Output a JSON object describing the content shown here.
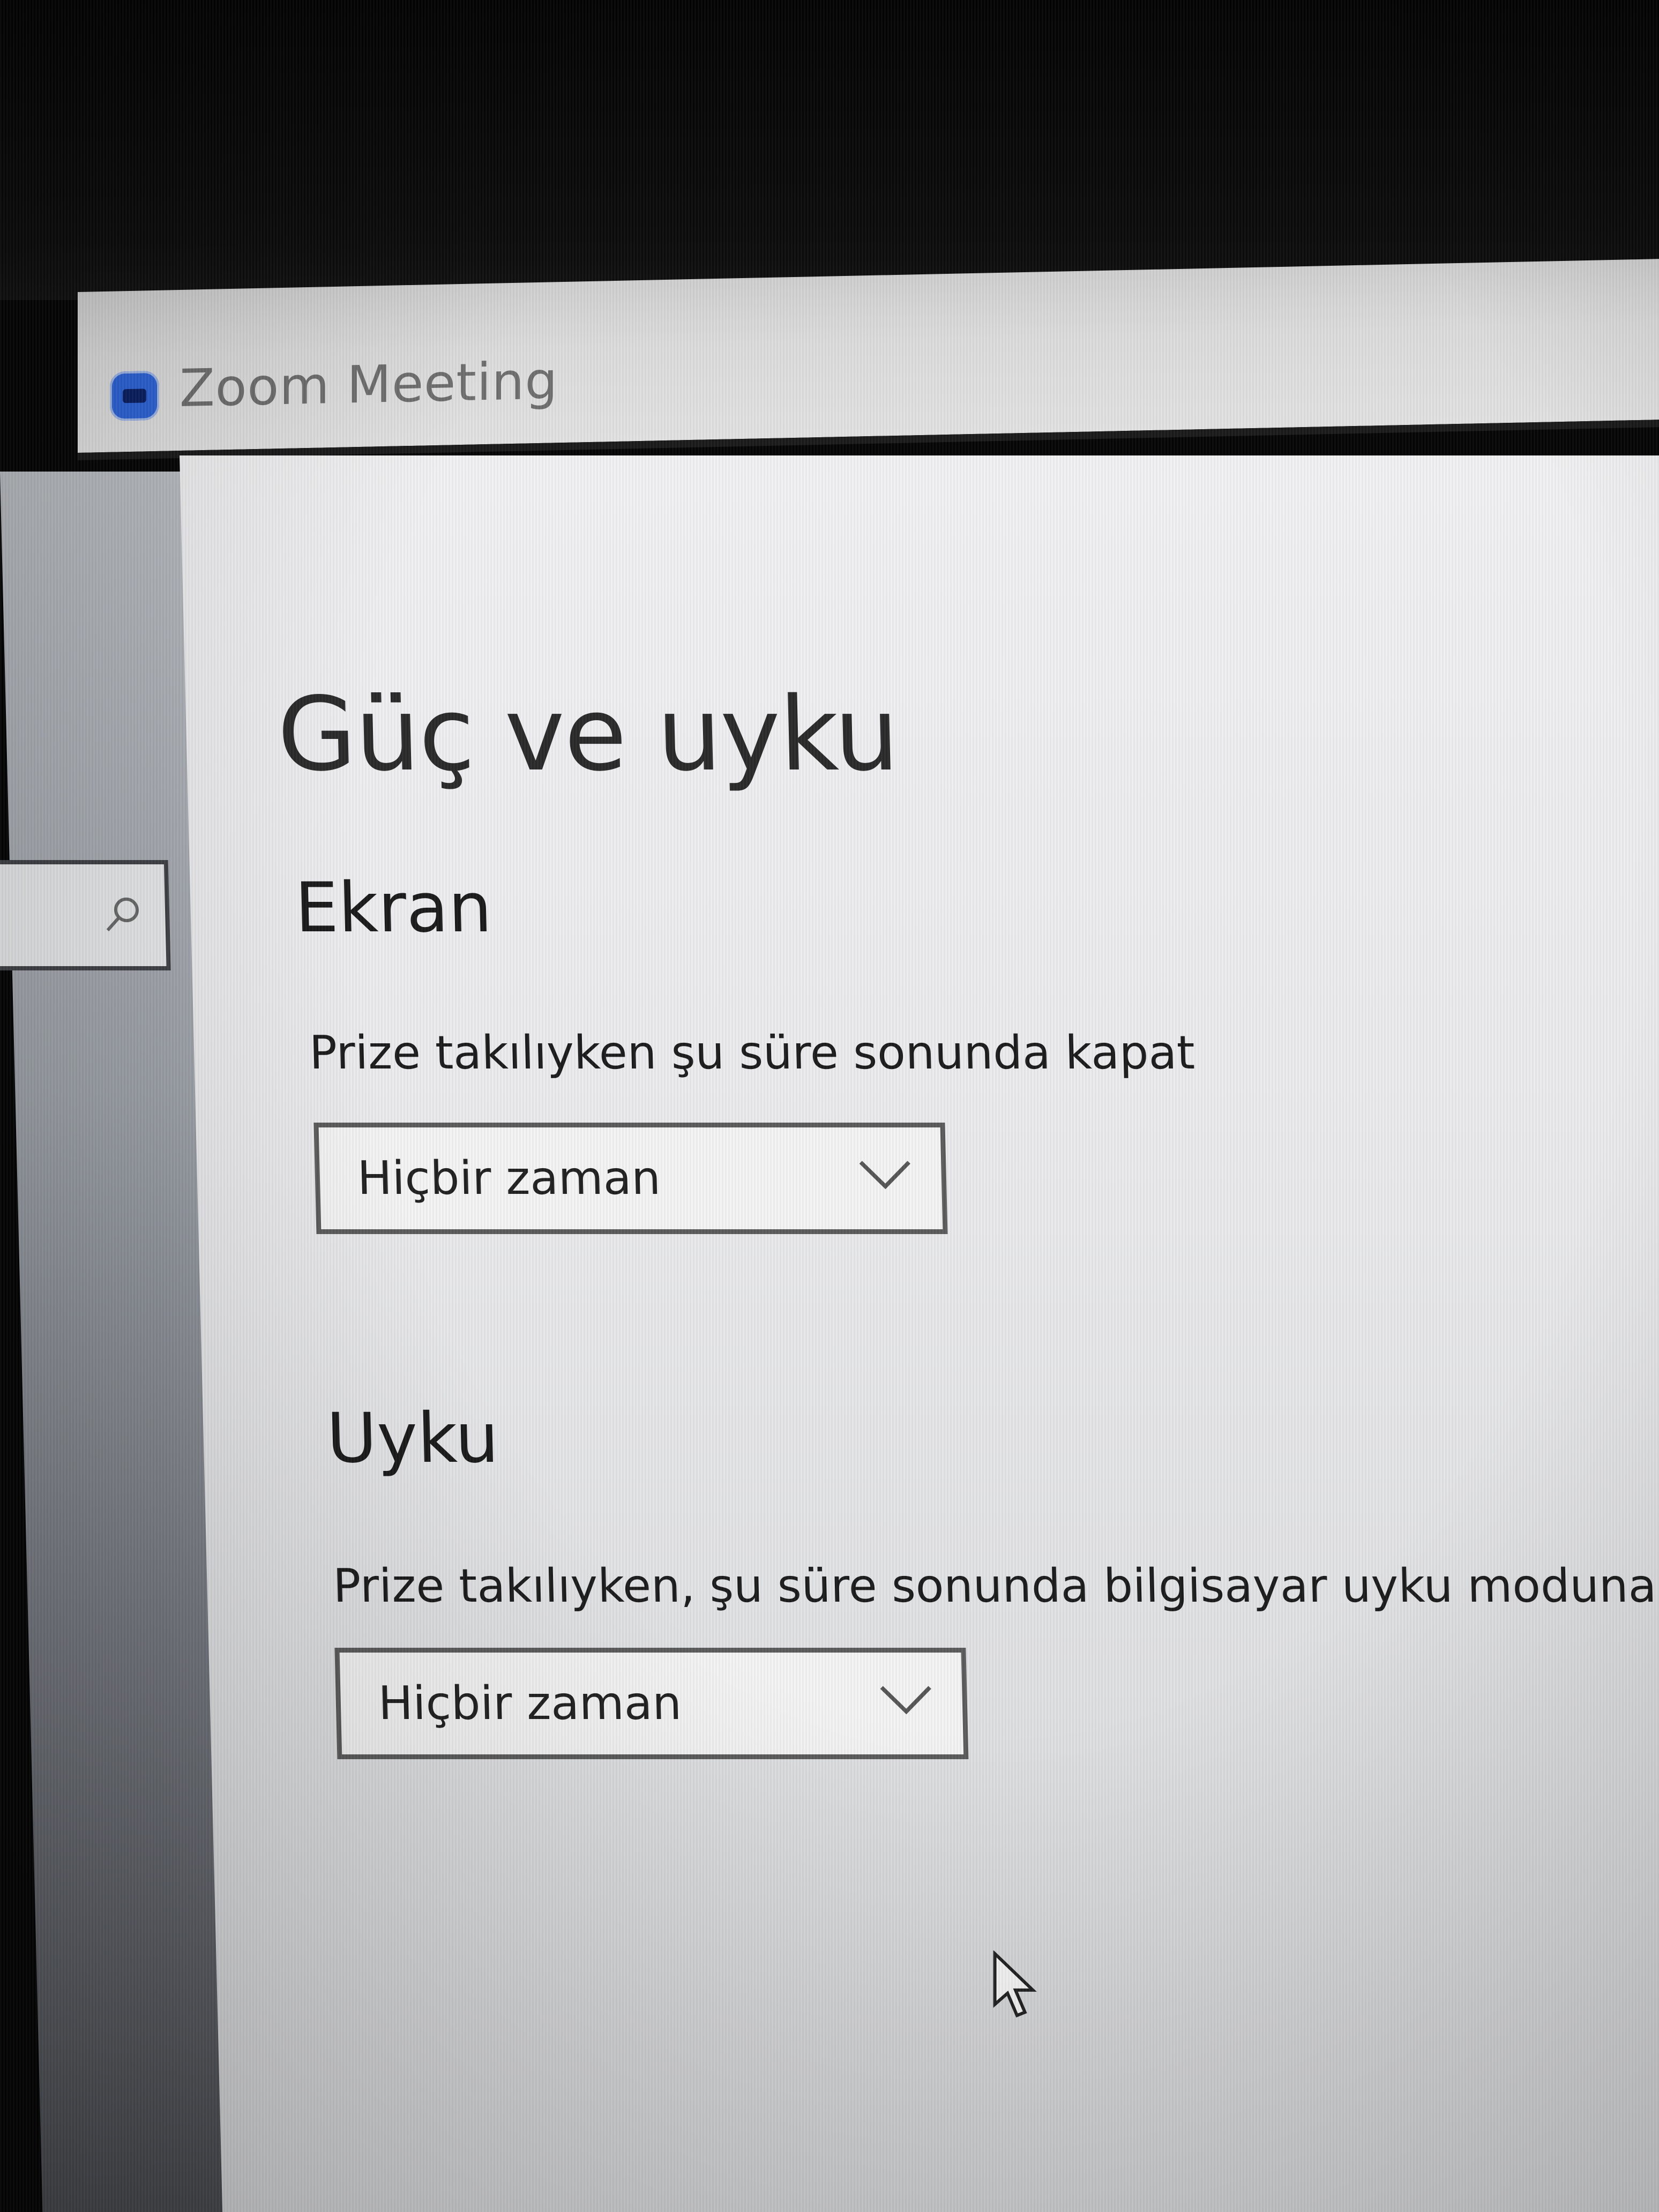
{
  "window": {
    "title": "Zoom Meeting"
  },
  "search": {
    "icon": "search-icon"
  },
  "page": {
    "title": "Güç ve uyku"
  },
  "display_section": {
    "heading": "Ekran",
    "label": "Prize takılıyken şu süre sonunda kapat",
    "selected": "Hiçbir zaman"
  },
  "sleep_section": {
    "heading": "Uyku",
    "label": "Prize takılıyken, şu süre sonunda bilgisayar uyku moduna geç",
    "selected": "Hiçbir zaman"
  },
  "colors": {
    "zoom_brand": "#2d63d6"
  }
}
